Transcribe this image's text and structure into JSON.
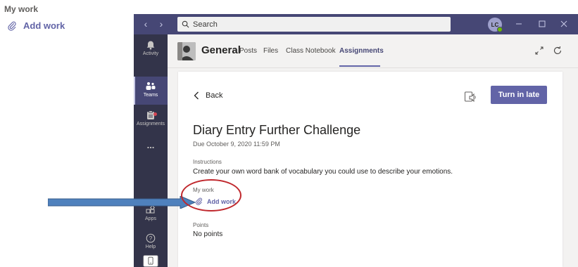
{
  "callout": {
    "heading": "My work",
    "add_work": "Add work"
  },
  "titlebar": {
    "search_placeholder": "Search",
    "user_initials": "LC"
  },
  "rail": {
    "items": [
      {
        "label": "Activity",
        "icon": "bell-icon"
      },
      {
        "label": "Teams",
        "icon": "teams-icon"
      },
      {
        "label": "Assignments",
        "icon": "assignments-icon"
      },
      {
        "label": "...",
        "icon": "more-icon"
      },
      {
        "label": "Apps",
        "icon": "apps-icon"
      },
      {
        "label": "Help",
        "icon": "help-icon"
      }
    ]
  },
  "channel": {
    "name": "General",
    "tabs": [
      "Posts",
      "Files",
      "Class Notebook",
      "Assignments"
    ],
    "active_tab": "Assignments"
  },
  "assignment": {
    "back_label": "Back",
    "turn_in_label": "Turn in late",
    "title": "Diary Entry Further Challenge",
    "due": "Due October 9, 2020 11:59 PM",
    "instructions_label": "Instructions",
    "instructions_text": "Create your own word bank  of vocabulary you could use to describe your emotions.",
    "my_work_label": "My work",
    "add_work_label": "Add work",
    "points_label": "Points",
    "points_value": "No points"
  },
  "colors": {
    "brand": "#6264a7",
    "titlebar": "#464775",
    "rail": "#33344a",
    "annotation_ring": "#c0282d",
    "annotation_arrow": "#4f81bd"
  }
}
